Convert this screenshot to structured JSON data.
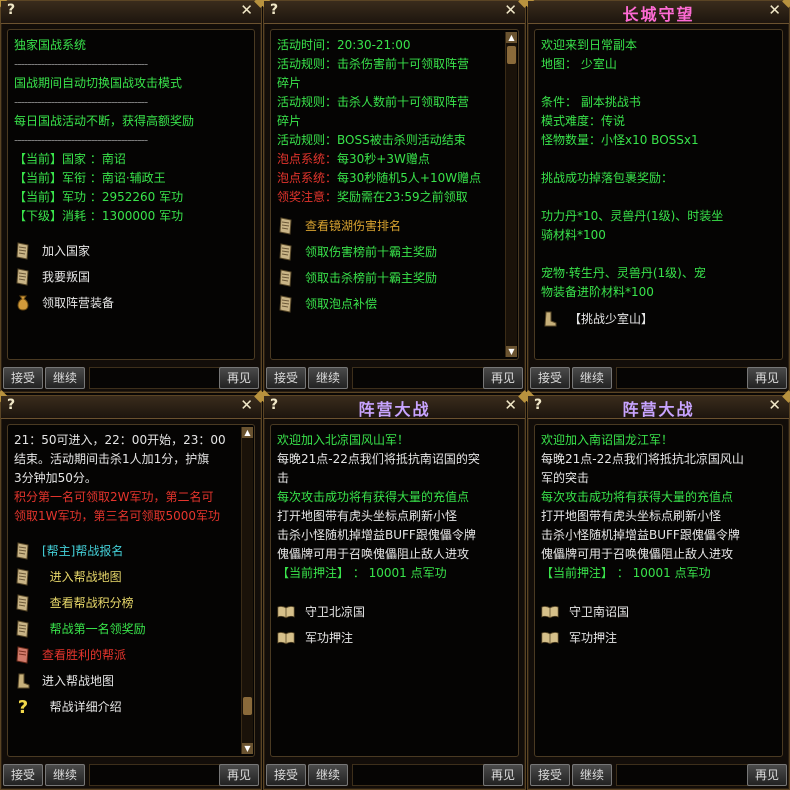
{
  "common": {
    "help": "?",
    "close": "✕",
    "accept": "接受",
    "continue": "继续",
    "goodbye": "再见"
  },
  "p1": {
    "lines": [
      {
        "t": "独家国战系统",
        "c": "g"
      },
      {
        "t": "----------------------------------------",
        "c": "dash"
      },
      {
        "t": "国战期间自动切换国战攻击模式",
        "c": "g"
      },
      {
        "t": "----------------------------------------",
        "c": "dash"
      },
      {
        "t": "每日国战活动不断，获得高额奖励",
        "c": "g"
      },
      {
        "t": "----------------------------------------",
        "c": "dash"
      },
      {
        "t": "【当前】国家  ：南诏",
        "c": "g"
      },
      {
        "t": "【当前】军衔  ：南诏·辅政王",
        "c": "g"
      },
      {
        "t": "【当前】军功  ：2952260 军功",
        "c": "g"
      },
      {
        "t": "【下级】消耗  ：1300000 军功",
        "c": "g"
      }
    ],
    "options": [
      {
        "label": "加入国家",
        "icon": "scroll-icon",
        "c": "w"
      },
      {
        "label": "我要叛国",
        "icon": "scroll-icon",
        "c": "w"
      },
      {
        "label": "领取阵营装备",
        "icon": "money-bag-icon",
        "c": "w"
      }
    ]
  },
  "p2": {
    "lines": [
      {
        "t": "活动时间：20:30-21:00",
        "c": "g"
      },
      {
        "t": "活动规则：击杀伤害前十可领取阵营",
        "c": "g"
      },
      {
        "t": "碎片",
        "c": "g"
      },
      {
        "t": "活动规则：击杀人数前十可领取阵营",
        "c": "g"
      },
      {
        "t": "碎片",
        "c": "g"
      },
      {
        "t": "活动规则：BOSS被击杀则活动结束",
        "c": "g"
      },
      {
        "t": "泡点系统：",
        "c": "r",
        "t2": "每30秒+3W赠点",
        "c2": "g"
      },
      {
        "t": "泡点系统：",
        "c": "r",
        "t2": "每30秒随机5人+10W赠点",
        "c2": "g"
      },
      {
        "t": "领奖注意：",
        "c": "r",
        "t2": "奖励需在23:59之前领取",
        "c2": "g"
      }
    ],
    "options": [
      {
        "label": "查看镜湖伤害排名",
        "icon": "scroll-icon",
        "c": "o"
      },
      {
        "label": "领取伤害榜前十霸主奖励",
        "icon": "scroll-icon",
        "c": "g"
      },
      {
        "label": "领取击杀榜前十霸主奖励",
        "icon": "scroll-icon",
        "c": "g"
      },
      {
        "label": "领取泡点补偿",
        "icon": "scroll-icon",
        "c": "g"
      }
    ]
  },
  "p3": {
    "title": "长城守望",
    "lines": [
      {
        "t": "欢迎来到日常副本",
        "c": "g"
      },
      {
        "t": "地图：  少室山",
        "c": "g"
      },
      {
        "t": "",
        "c": "g"
      },
      {
        "t": "条件：  副本挑战书",
        "c": "g"
      },
      {
        "t": "模式难度：传说",
        "c": "g"
      },
      {
        "t": "怪物数量：小怪x10   BOSSx1",
        "c": "g"
      },
      {
        "t": "",
        "c": "g"
      },
      {
        "t": "挑战成功掉落包裹奖励：",
        "c": "g"
      },
      {
        "t": "",
        "c": "g"
      },
      {
        "t": "功力丹*10、灵兽丹(1级)、时装坐",
        "c": "g"
      },
      {
        "t": "骑材料*100",
        "c": "g"
      },
      {
        "t": "",
        "c": "g"
      },
      {
        "t": "宠物·转生丹、灵兽丹(1级)、宠",
        "c": "g"
      },
      {
        "t": "物装备进阶材料*100",
        "c": "g"
      }
    ],
    "options": [
      {
        "label": "【挑战少室山】",
        "icon": "boot-icon",
        "c": "w"
      }
    ]
  },
  "p4": {
    "lines": [
      {
        "t": "21：50可进入，22：00开始，23：00",
        "c": "w"
      },
      {
        "t": "结束。活动期间击杀1人加1分，护旗",
        "c": "w"
      },
      {
        "t": "3分钟加50分。",
        "c": "w"
      },
      {
        "t": "积分第一名可领取2W军功，第二名可",
        "c": "r"
      },
      {
        "t": "领取1W军功，第三名可领取5000军功",
        "c": "r"
      }
    ],
    "options": [
      {
        "label": "[帮主]帮战报名",
        "icon": "scroll-icon",
        "c": "c"
      },
      {
        "label": "  进入帮战地图",
        "icon": "scroll-icon",
        "c": "y"
      },
      {
        "label": "  查看帮战积分榜",
        "icon": "scroll-icon",
        "c": "y"
      },
      {
        "label": "  帮战第一名领奖励",
        "icon": "scroll-icon",
        "c": "g"
      },
      {
        "label": "查看胜利的帮派",
        "icon": "scroll-red-icon",
        "c": "r"
      },
      {
        "label": "进入帮战地图",
        "icon": "boot-icon",
        "c": "w"
      },
      {
        "label": "  帮战详细介绍",
        "icon": "question-icon",
        "c": "w"
      }
    ]
  },
  "p5": {
    "title": "阵营大战",
    "lines": [
      {
        "t": "欢迎加入北凉国风山军！",
        "c": "g"
      },
      {
        "t": "每晚21点-22点我们将抵抗南诏国的突",
        "c": "w"
      },
      {
        "t": "击",
        "c": "w"
      },
      {
        "t": "每次攻击成功将有获得大量的充值点",
        "c": "g"
      },
      {
        "t": "打开地图带有虎头坐标点刷新小怪",
        "c": "w"
      },
      {
        "t": "击杀小怪随机掉增益BUFF跟傀儡令牌",
        "c": "w"
      },
      {
        "t": "傀儡牌可用于召唤傀儡阻止敌人进攻",
        "c": "w"
      },
      {
        "t": "【当前押注】  ：  10001   点军功",
        "c": "g"
      }
    ],
    "options": [
      {
        "label": "守卫北凉国",
        "icon": "book-icon",
        "c": "w"
      },
      {
        "label": "军功押注",
        "icon": "book-icon",
        "c": "w"
      }
    ]
  },
  "p6": {
    "title": "阵营大战",
    "lines": [
      {
        "t": "欢迎加入南诏国龙江军！",
        "c": "g"
      },
      {
        "t": "每晚21点-22点我们将抵抗北凉国风山",
        "c": "w"
      },
      {
        "t": "军的突击",
        "c": "w"
      },
      {
        "t": "每次攻击成功将有获得大量的充值点",
        "c": "g"
      },
      {
        "t": "打开地图带有虎头坐标点刷新小怪",
        "c": "w"
      },
      {
        "t": "击杀小怪随机掉增益BUFF跟傀儡令牌",
        "c": "w"
      },
      {
        "t": "傀儡牌可用于召唤傀儡阻止敌人进攻",
        "c": "w"
      },
      {
        "t": "【当前押注】  ：  10001   点军功",
        "c": "g"
      }
    ],
    "options": [
      {
        "label": "守卫南诏国",
        "icon": "book-icon",
        "c": "w"
      },
      {
        "label": "军功押注",
        "icon": "book-icon",
        "c": "w"
      }
    ]
  }
}
